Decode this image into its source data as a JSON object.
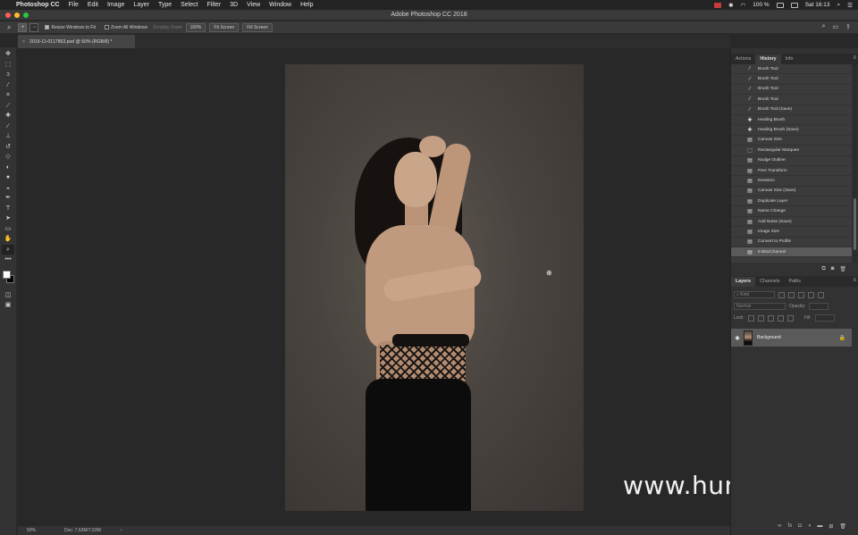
{
  "menubar": {
    "app_name": "Photoshop CC",
    "items": [
      "File",
      "Edit",
      "Image",
      "Layer",
      "Type",
      "Select",
      "Filter",
      "3D",
      "View",
      "Window",
      "Help"
    ],
    "battery": "100 %",
    "clock": "Sat 16:13"
  },
  "window": {
    "title": "Adobe Photoshop CC 2018",
    "colors": {
      "close": "#ff5f57",
      "minimize": "#febc2e",
      "zoom": "#28c840"
    }
  },
  "options": {
    "resize_windows": "Resize Windows to Fit",
    "zoom_all": "Zoom All Windows",
    "scrubby_zoom": "Scrubby Zoom",
    "zoom_value": "100%",
    "fit_screen": "Fit Screen",
    "fill_screen": "Fill Screen"
  },
  "document": {
    "tab_label": "2019-11-0117863.psd @ 50% (RGB/8) *"
  },
  "toolbar": {
    "tools": [
      "move-tool",
      "marquee-tool",
      "lasso-tool",
      "quick-select-tool",
      "crop-tool",
      "eyedropper-tool",
      "healing-tool",
      "brush-tool",
      "clone-stamp-tool",
      "history-brush-tool",
      "eraser-tool",
      "gradient-tool",
      "blur-tool",
      "dodge-tool",
      "pen-tool",
      "type-tool",
      "path-select-tool",
      "shape-tool",
      "hand-tool",
      "zoom-tool",
      "more-tools"
    ],
    "foreground": "#ffffff",
    "background": "#000000"
  },
  "status": {
    "zoom": "50%",
    "doc": "Doc: 7,63M/7,63M"
  },
  "watermark": "www.hunls.com",
  "history": {
    "tabs": [
      "Actions",
      "History",
      "Info"
    ],
    "active_tab": "History",
    "items": [
      {
        "label": "Brush Tool",
        "icon": "brush-icon"
      },
      {
        "label": "Brush Tool",
        "icon": "brush-icon"
      },
      {
        "label": "Brush Tool",
        "icon": "brush-icon"
      },
      {
        "label": "Brush Tool",
        "icon": "brush-icon"
      },
      {
        "label": "Brush Tool (Save)",
        "icon": "brush-icon"
      },
      {
        "label": "Healing Brush",
        "icon": "bandage-icon"
      },
      {
        "label": "Healing Brush (Save)",
        "icon": "bandage-icon"
      },
      {
        "label": "Canvas Size",
        "icon": "document-icon"
      },
      {
        "label": "Rectangular Marquee",
        "icon": "marquee-icon"
      },
      {
        "label": "Nudge Outline",
        "icon": "document-icon"
      },
      {
        "label": "Free Transform",
        "icon": "document-icon"
      },
      {
        "label": "Deselect",
        "icon": "document-icon"
      },
      {
        "label": "Canvas Size (Save)",
        "icon": "document-icon"
      },
      {
        "label": "Duplicate Layer",
        "icon": "document-icon"
      },
      {
        "label": "Name Change",
        "icon": "document-icon"
      },
      {
        "label": "Add Noise (Save)",
        "icon": "document-icon"
      },
      {
        "label": "Image Size",
        "icon": "document-icon"
      },
      {
        "label": "Convert to Profile",
        "icon": "document-icon"
      },
      {
        "label": "8 Bits/Channel",
        "icon": "document-icon"
      }
    ],
    "selected_index": 18
  },
  "layers": {
    "tabs": [
      "Layers",
      "Channels",
      "Paths"
    ],
    "active_tab": "Layers",
    "filter_kind": "Kind",
    "blend_mode": "Normal",
    "opacity_label": "Opacity:",
    "lock_label": "Lock:",
    "fill_label": "Fill:",
    "items": [
      {
        "name": "Background",
        "locked": true,
        "visible": true
      }
    ],
    "footer_icons": [
      "link-icon",
      "fx-icon",
      "mask-icon",
      "adjustment-icon",
      "folder-icon",
      "new-layer-icon",
      "trash-icon"
    ]
  }
}
